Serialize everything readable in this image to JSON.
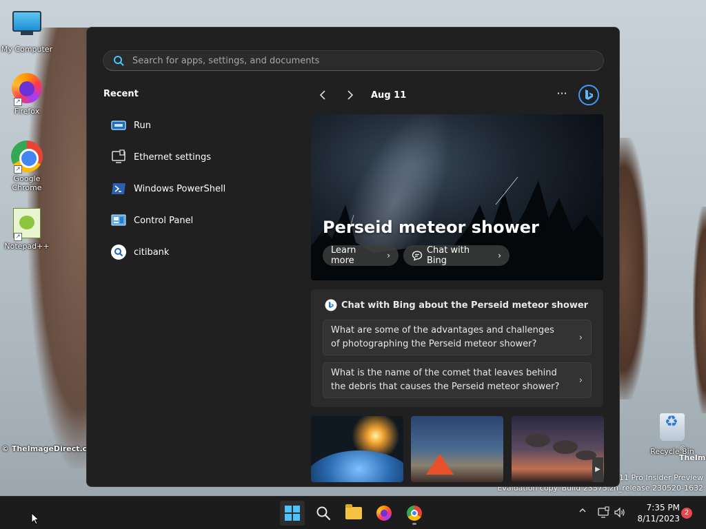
{
  "desktop": {
    "icons": [
      {
        "label": "My Computer"
      },
      {
        "label": "Firefox"
      },
      {
        "label": "Google Chrome"
      },
      {
        "label": "Notepad++"
      },
      {
        "label": "Recycle Bin"
      }
    ],
    "watermark_left": "© TheImageDirect.com",
    "watermark_right": "© TheImageDi",
    "eval_line1": "11 Pro Insider Preview",
    "eval_line2": "Evaluation copy. Build 23575.zn_release.230520-1632"
  },
  "start_menu": {
    "search": {
      "placeholder": "Search for apps, settings, and documents",
      "value": ""
    },
    "recent_title": "Recent",
    "recent_items": [
      {
        "label": "Run",
        "icon": "run-icon"
      },
      {
        "label": "Ethernet settings",
        "icon": "ethernet-icon"
      },
      {
        "label": "Windows PowerShell",
        "icon": "powershell-icon"
      },
      {
        "label": "Control Panel",
        "icon": "control-panel-icon"
      },
      {
        "label": "citibank",
        "icon": "search-icon"
      }
    ],
    "feed": {
      "date": "Aug 11",
      "more": "···",
      "hero_title": "Perseid meteor shower",
      "learn_more": "Learn more",
      "chat_with_bing": "Chat with Bing",
      "bing_card_title": "Chat with Bing about the Perseid meteor shower",
      "questions": [
        "What are some of the advantages and challenges of photographing the Perseid meteor shower?",
        "What is the name of the comet that leaves behind the debris that causes the Perseid meteor shower?"
      ]
    }
  },
  "taskbar": {
    "time": "7:35 PM",
    "date": "8/11/2023",
    "notification_count": "2"
  },
  "colors": {
    "accent": "#4cc2ff",
    "menu_bg": "#202020",
    "card_bg": "#2b2b2b",
    "badge": "#e5484d"
  }
}
